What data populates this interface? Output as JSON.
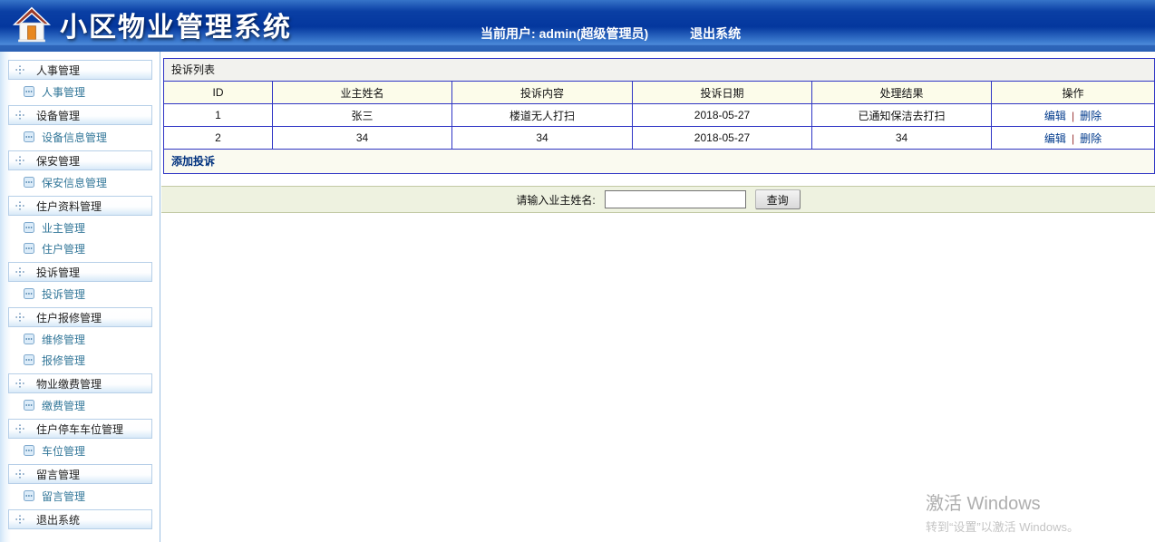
{
  "header": {
    "title": "小区物业管理系统",
    "current_user_label": "当前用户:",
    "current_user": "admin(超级管理员)",
    "logout": "退出系统"
  },
  "sidebar": {
    "items": [
      {
        "label": "人事管理",
        "type": "category"
      },
      {
        "label": "人事管理",
        "type": "sub"
      },
      {
        "label": "设备管理",
        "type": "category"
      },
      {
        "label": "设备信息管理",
        "type": "sub"
      },
      {
        "label": "保安管理",
        "type": "category"
      },
      {
        "label": "保安信息管理",
        "type": "sub"
      },
      {
        "label": "住户资料管理",
        "type": "category"
      },
      {
        "label": "业主管理",
        "type": "sub"
      },
      {
        "label": "住户管理",
        "type": "sub"
      },
      {
        "label": "投诉管理",
        "type": "category"
      },
      {
        "label": "投诉管理",
        "type": "sub"
      },
      {
        "label": "住户报修管理",
        "type": "category"
      },
      {
        "label": "维修管理",
        "type": "sub"
      },
      {
        "label": "报修管理",
        "type": "sub"
      },
      {
        "label": "物业缴费管理",
        "type": "category"
      },
      {
        "label": "缴费管理",
        "type": "sub"
      },
      {
        "label": "住户停车车位管理",
        "type": "category"
      },
      {
        "label": "车位管理",
        "type": "sub"
      },
      {
        "label": "留言管理",
        "type": "category"
      },
      {
        "label": "留言管理",
        "type": "sub"
      },
      {
        "label": "退出系统",
        "type": "category"
      }
    ]
  },
  "main": {
    "list_title": "投诉列表",
    "table": {
      "columns": [
        "ID",
        "业主姓名",
        "投诉内容",
        "投诉日期",
        "处理结果",
        "操作"
      ],
      "rows": [
        [
          "1",
          "张三",
          "楼道无人打扫",
          "2018-05-27",
          "已通知保洁去打扫"
        ],
        [
          "2",
          "34",
          "34",
          "2018-05-27",
          "34"
        ]
      ],
      "actions": {
        "edit": "编辑",
        "separator": "|",
        "delete": "删除"
      }
    },
    "add_link": "添加投诉",
    "search": {
      "label": "请输入业主姓名:",
      "value": "",
      "button": "查询"
    }
  },
  "watermark": {
    "line1": "激活 Windows",
    "line2": "转到“设置”以激活 Windows。"
  },
  "colors": {
    "header_dark_blue": "#04379e",
    "header_light_blue": "#4f8cdc",
    "table_border_blue": "#2f35c5",
    "table_header_bg": "#fcfcea",
    "caption_bg": "#f2f2ee",
    "search_bar_bg": "#eef2e0",
    "sub_link_color": "#337799",
    "action_link_color": "#003a8c",
    "separator_color": "#993333",
    "add_link_color": "#00317e"
  }
}
